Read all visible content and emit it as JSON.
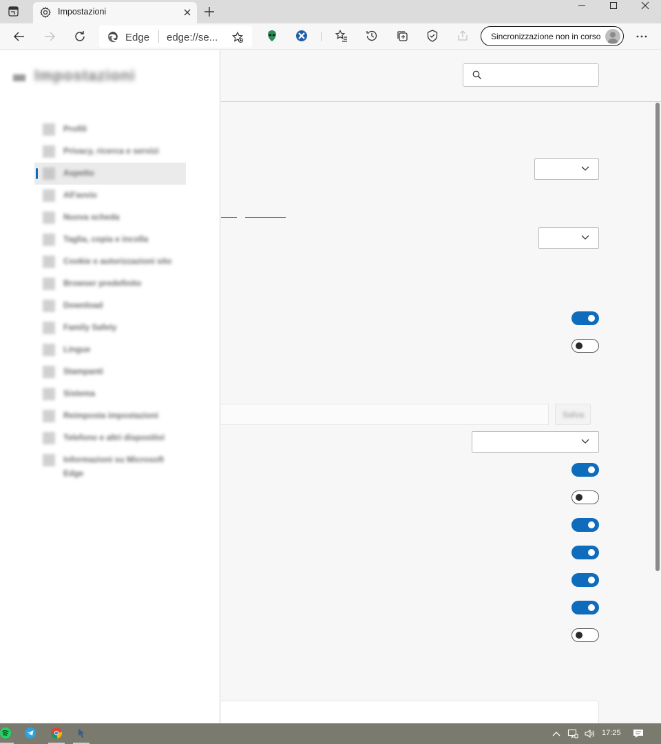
{
  "browser": {
    "tab_title": "Impostazioni",
    "address_brand": "Edge",
    "address_url": "edge://se...",
    "sync_label": "Sincronizzazione non in corso"
  },
  "settings": {
    "page_title": "Impostazioni",
    "nav_items": [
      {
        "label": "Profili"
      },
      {
        "label": "Privacy, ricerca e servizi"
      },
      {
        "label": "Aspetto"
      },
      {
        "label": "All'avvio"
      },
      {
        "label": "Nuova scheda"
      },
      {
        "label": "Taglia, copia e incolla"
      },
      {
        "label": "Cookie e autorizzazioni sito"
      },
      {
        "label": "Browser predefinito"
      },
      {
        "label": "Download"
      },
      {
        "label": "Family Safety"
      },
      {
        "label": "Lingue"
      },
      {
        "label": "Stampanti"
      },
      {
        "label": "Sistema"
      },
      {
        "label": "Reimposta impostazioni"
      },
      {
        "label": "Telefono e altri dispositivi"
      },
      {
        "label": "Informazioni su Microsoft",
        "label2": "Edge"
      }
    ],
    "add_button": "Salva",
    "toggles": [
      {
        "state": "on"
      },
      {
        "state": "off"
      },
      {
        "state": "on"
      },
      {
        "state": "off"
      },
      {
        "state": "on"
      },
      {
        "state": "on"
      },
      {
        "state": "on"
      },
      {
        "state": "on"
      },
      {
        "state": "off"
      }
    ]
  },
  "taskbar": {
    "clock": "17:25",
    "apps": [
      "spotify-icon",
      "telegram-icon",
      "chrome-icon",
      "app-icon"
    ]
  },
  "colors": {
    "accent": "#0f6cbd",
    "titlebar": "#dcdcdc",
    "taskbar": "#7a7a6e"
  }
}
